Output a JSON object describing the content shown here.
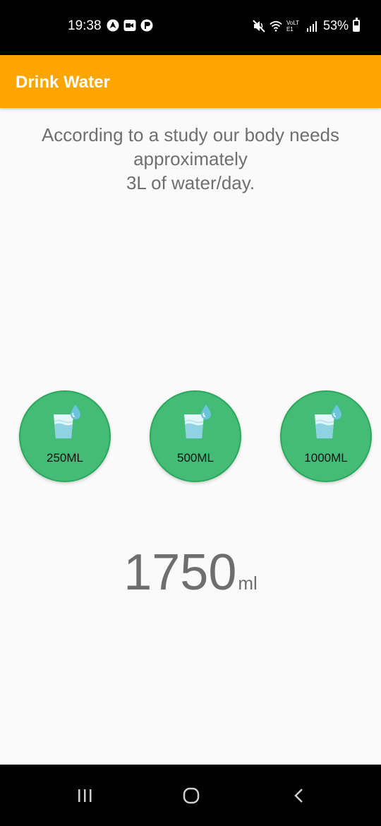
{
  "status_bar": {
    "time": "19:38",
    "battery": "53%",
    "network_label": "VoLTE1"
  },
  "app_bar": {
    "title": "Drink Water"
  },
  "info": {
    "line1": "According to a study our body needs",
    "line2": "approximately",
    "line3": "3L of water/day."
  },
  "buttons": [
    {
      "label": "250ML",
      "icon": "water-glass-icon"
    },
    {
      "label": "500ML",
      "icon": "water-glass-icon"
    },
    {
      "label": "1000ML",
      "icon": "water-glass-icon"
    }
  ],
  "total": {
    "value": "1750",
    "unit": "ml"
  },
  "colors": {
    "app_bar": "#ffa500",
    "button_fill": "#45bb78",
    "button_border": "#2aa95a",
    "text_gray": "#6f6f6f"
  },
  "nav": {
    "icons": [
      "recents-icon",
      "home-icon",
      "back-icon"
    ]
  }
}
